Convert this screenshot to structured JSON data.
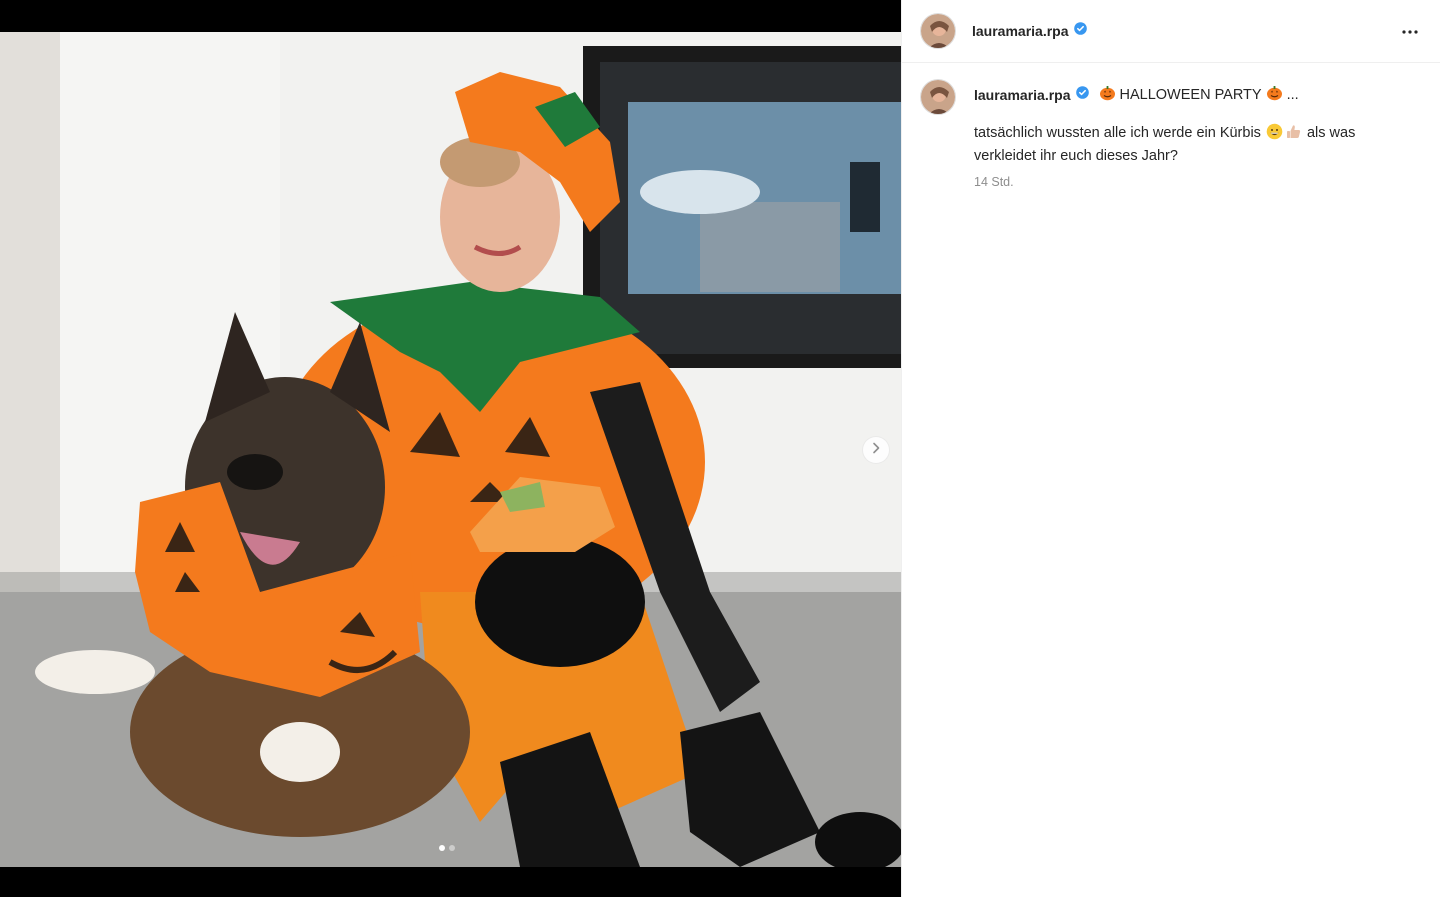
{
  "post": {
    "username": "lauramaria.rpa",
    "verified": true,
    "more_label": "more-options",
    "caption": {
      "headline": "HALLOWEEN PARTY",
      "ellipsis": "...",
      "text_before": "tatsächlich wussten alle ich werde ein Kürbis",
      "text_after": "als was verkleidet ihr euch dieses Jahr?",
      "emojis": [
        "pumpkin",
        "grinning-face",
        "thumbs-up"
      ]
    },
    "timestamp": "14 Std."
  },
  "carousel": {
    "slide_count": 2,
    "current_slide": 1,
    "next_icon": "chevron-right-icon"
  },
  "colors": {
    "verified_blue": "#3897f0",
    "text_primary": "#262626",
    "text_secondary": "#8e8e8e",
    "pumpkin_orange": "#f47a1d",
    "leaf_green": "#1f7a3a"
  }
}
